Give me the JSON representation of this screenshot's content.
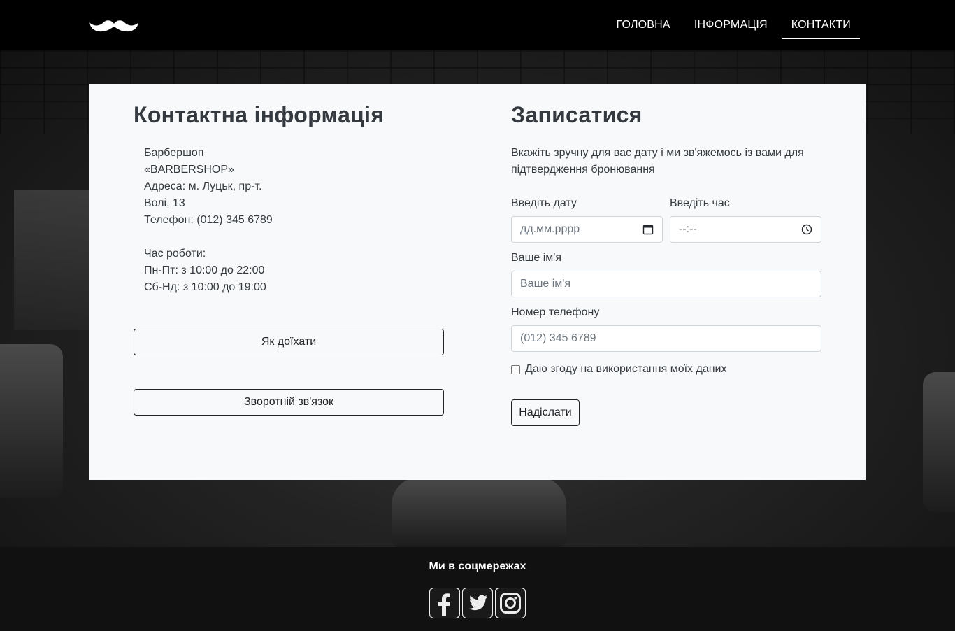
{
  "nav": {
    "items": [
      {
        "label": "ГОЛОВНА"
      },
      {
        "label": "ІНФОРМАЦІЯ"
      },
      {
        "label": "КОНТАКТИ"
      }
    ]
  },
  "contact": {
    "title": "Контактна інформація",
    "lines": [
      "Барбершоп",
      "«BARBERSHOP»",
      "Адреса: м. Луцьк, пр-т.",
      "Волі, 13",
      "Телефон: (012) 345 6789"
    ],
    "hours": [
      "Час роботи:",
      "Пн-Пт: з 10:00 до 22:00",
      "Сб-Нд: з 10:00 до 19:00"
    ],
    "route_button": "Як доїхати",
    "feedback_button": "Зворотній зв'язок"
  },
  "booking": {
    "title": "Записатися",
    "lead": "Вкажіть зручну для вас дату і ми зв'яжемось із вами для підтвердження бронювання",
    "date_label": "Введіть дату",
    "date_placeholder": "дд.мм.рррр",
    "time_label": "Введіть час",
    "time_placeholder": "--:--",
    "name_label": "Ваше ім'я",
    "name_placeholder": "Ваше ім'я",
    "phone_label": "Номер телефону",
    "phone_placeholder": "(012) 345 6789",
    "consent_label": "Даю згоду на використання моїх даних",
    "submit": "Надіслати"
  },
  "footer": {
    "title": "Ми в соцмережах",
    "socials": [
      "facebook-icon",
      "twitter-icon",
      "instagram-icon"
    ]
  }
}
